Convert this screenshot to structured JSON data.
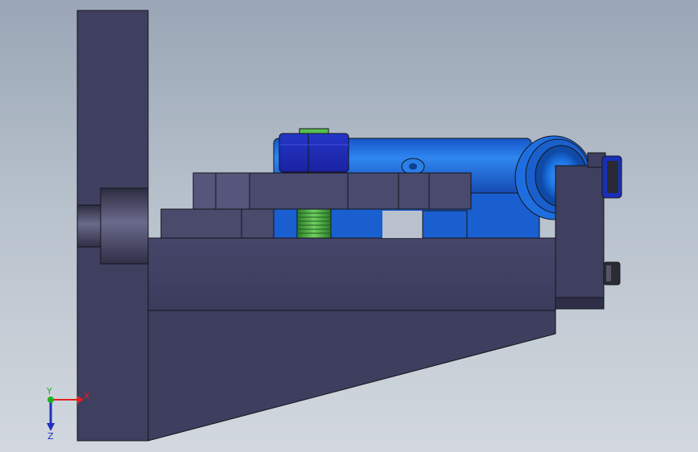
{
  "triad": {
    "x_label": "X",
    "y_label": "Y",
    "z_label": "Z",
    "x_color": "#e02020",
    "y_color": "#20b020",
    "z_color": "#2030c0"
  },
  "colors": {
    "background_top": "#9aa6b6",
    "background_bottom": "#d2d8de",
    "steel_body": "#3f3f5f",
    "steel_light": "#58587a",
    "blue_cylinder": "#1f6fe0",
    "blue_dark": "#1448a8",
    "thread_green": "#46a83e"
  }
}
